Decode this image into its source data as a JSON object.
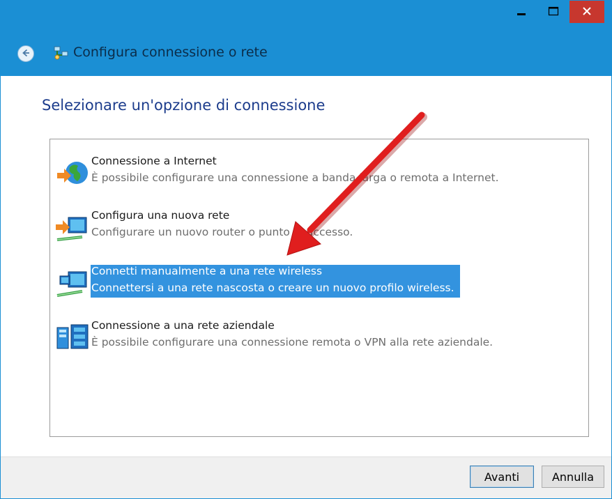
{
  "window": {
    "title": "Configura connessione o rete",
    "controls": {
      "minimize": "minimize-icon",
      "maximize": "maximize-icon",
      "close": "close-icon"
    }
  },
  "main": {
    "heading": "Selezionare un'opzione di connessione",
    "options": [
      {
        "title": "Connessione a Internet",
        "description": "È possibile configurare una connessione a banda larga o remota a Internet.",
        "icon": "globe-network-icon",
        "selected": false
      },
      {
        "title": "Configura una nuova rete",
        "description": "Configurare un nuovo router o punto di accesso.",
        "icon": "router-setup-icon",
        "selected": false
      },
      {
        "title": "Connetti manualmente a una rete wireless",
        "description": "Connettersi a una rete nascosta o creare un nuovo profilo wireless.",
        "icon": "wireless-network-icon",
        "selected": true
      },
      {
        "title": "Connessione a una rete aziendale",
        "description": "È possibile configurare una connessione remota o VPN alla rete aziendale.",
        "icon": "workplace-network-icon",
        "selected": false
      }
    ]
  },
  "footer": {
    "next_label": "Avanti",
    "cancel_label": "Annulla"
  },
  "colors": {
    "titlebar": "#1b8fd4",
    "close": "#c7372e",
    "selection": "#3393df",
    "heading": "#1c3c8c",
    "arrow": "#e01e1e"
  }
}
